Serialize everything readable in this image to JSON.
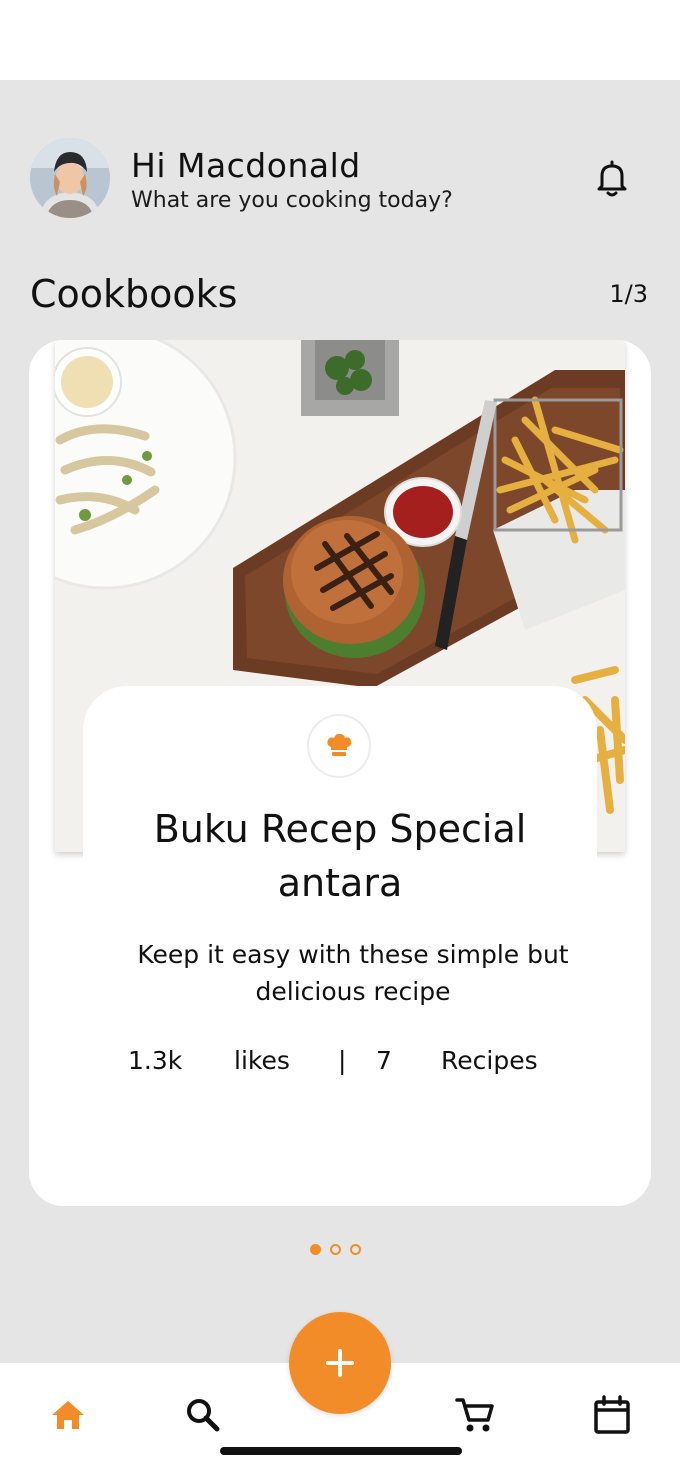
{
  "header": {
    "greeting": "Hi Macdonald",
    "subtitle": "What are you cooking today?",
    "avatar_icon": "avatar",
    "notification_icon": "bell-icon"
  },
  "section": {
    "title": "Cookbooks",
    "pager": "1/3"
  },
  "cookbook": {
    "badge_icon": "chef-hat-icon",
    "title": "Buku Recep Special antara",
    "description": "Keep it easy with these simple but delicious recipe",
    "likes_count": "1.3k",
    "likes_label": "likes",
    "separator": "|",
    "recipes_count": "7",
    "recipes_label": "Recipes"
  },
  "carousel": {
    "current_page": 1,
    "total_pages": 3
  },
  "tabbar": {
    "items": [
      {
        "name": "home-icon",
        "active": true
      },
      {
        "name": "search-icon",
        "active": false
      },
      {
        "name": "cart-icon",
        "active": false
      },
      {
        "name": "calendar-icon",
        "active": false
      }
    ],
    "fab_icon": "plus-icon"
  },
  "colors": {
    "accent": "#f28c28",
    "background": "#e5e5e5",
    "card": "#ffffff",
    "text": "#111111"
  }
}
